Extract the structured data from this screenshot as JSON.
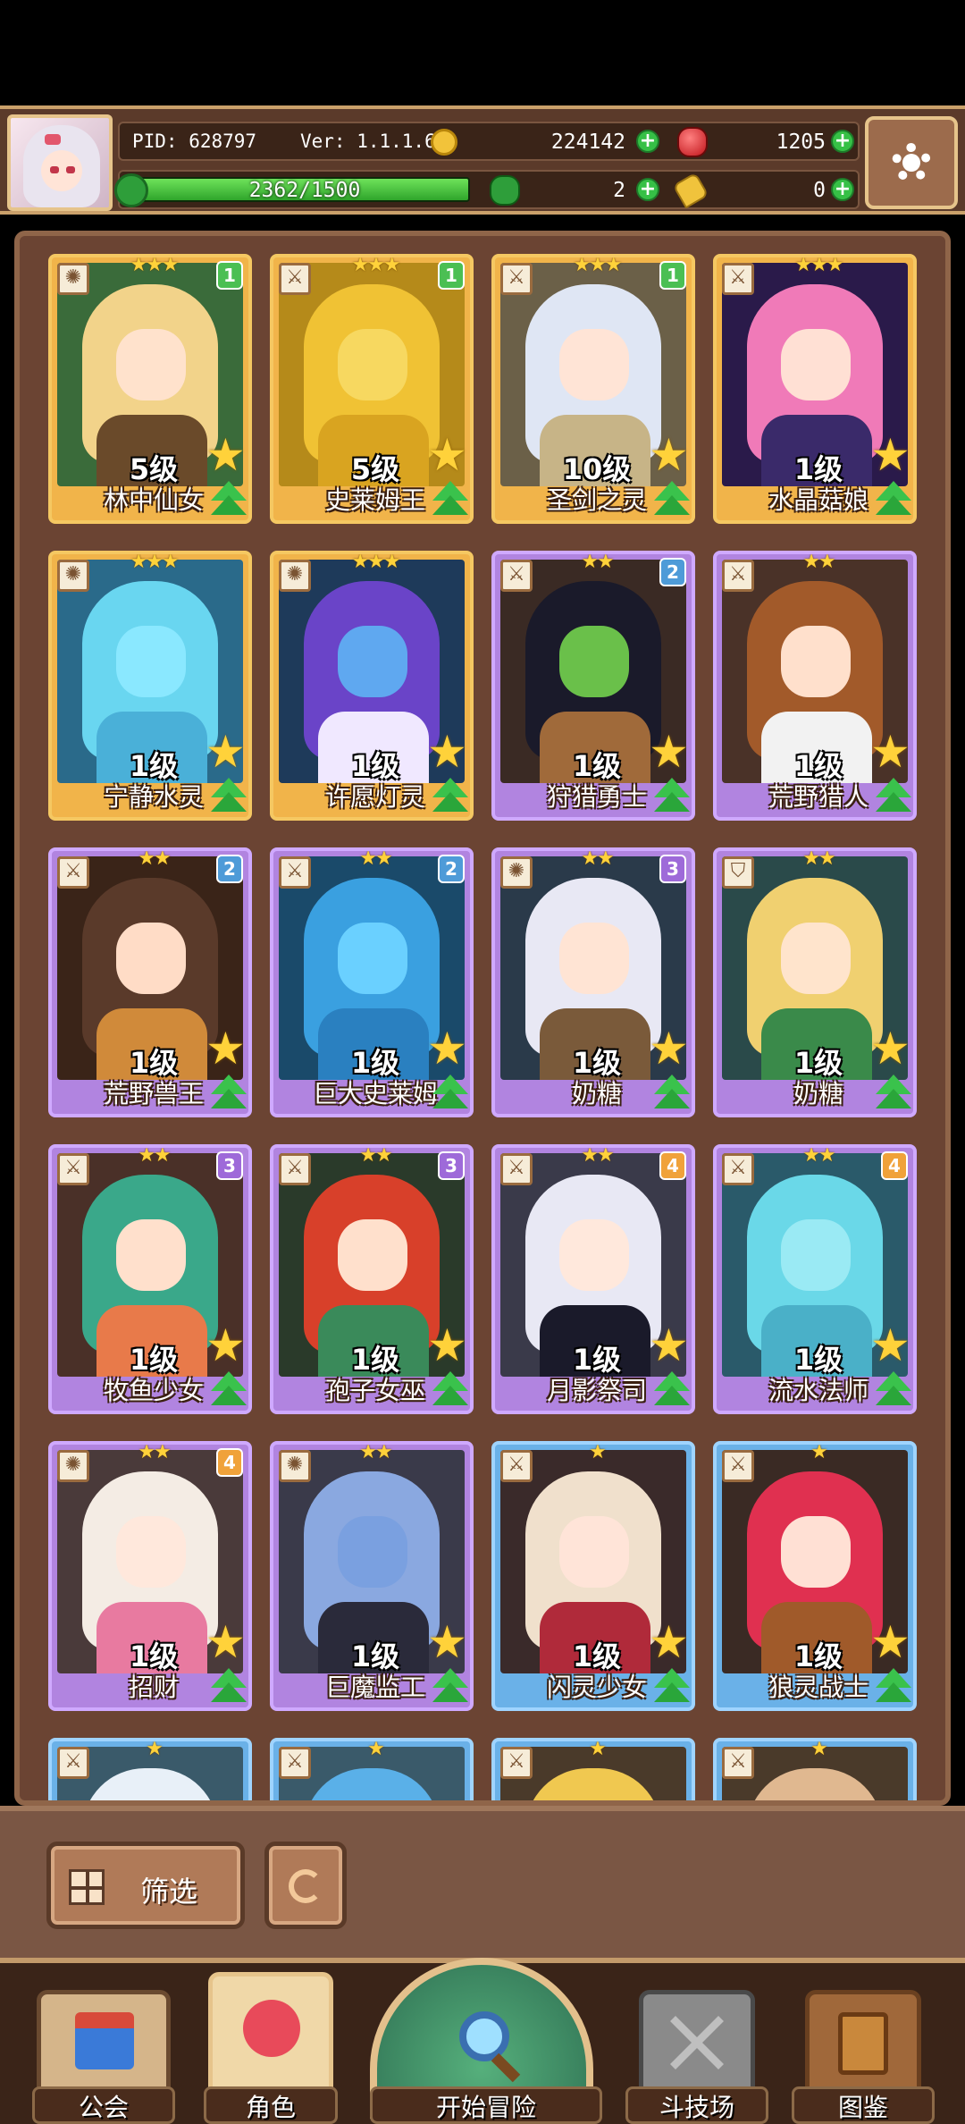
{
  "header": {
    "pid": "PID: 628797",
    "version": "Ver: 1.1.1.6",
    "gold": "224142",
    "gems": "1205",
    "stamina": "2362/1500",
    "stamina_fill": 1.0,
    "clovers": "2",
    "keys": "0",
    "plus_symbol": "+"
  },
  "cards": [
    {
      "name": "林中仙女",
      "level": "5级",
      "stars": "★★★",
      "copies": "1",
      "frame": "gold",
      "badge": "green",
      "icon": "gear-icon",
      "palette": [
        "#3a6b3a",
        "#f2d38a",
        "#ffe2cc",
        "#6a4a2a"
      ]
    },
    {
      "name": "史莱姆王",
      "level": "5级",
      "stars": "★★★",
      "copies": "1",
      "frame": "gold",
      "badge": "green",
      "icon": "sword-icon",
      "palette": [
        "#b58a1a",
        "#f0c234",
        "#f7d860",
        "#d9a420"
      ]
    },
    {
      "name": "圣剑之灵",
      "level": "10级",
      "stars": "★★★",
      "copies": "1",
      "frame": "gold",
      "badge": "green",
      "icon": "sword-icon",
      "palette": [
        "#6b6048",
        "#dfe6f4",
        "#ffe4d6",
        "#c7b487"
      ]
    },
    {
      "name": "水晶菇娘",
      "level": "1级",
      "stars": "★★★",
      "copies": "",
      "frame": "gold",
      "badge": "",
      "icon": "sword-icon",
      "palette": [
        "#2a1a4a",
        "#f07ab8",
        "#ffe0d4",
        "#3a2a6a"
      ]
    },
    {
      "name": "宁静水灵",
      "level": "1级",
      "stars": "★★★",
      "copies": "",
      "frame": "gold",
      "badge": "",
      "icon": "gear-icon",
      "palette": [
        "#2a6a8a",
        "#69d6f0",
        "#8ae8ff",
        "#4ab0d8"
      ]
    },
    {
      "name": "许愿灯灵",
      "level": "1级",
      "stars": "★★★",
      "copies": "",
      "frame": "gold",
      "badge": "",
      "icon": "gear-icon",
      "palette": [
        "#1e3a5a",
        "#6a44c8",
        "#5fa8f0",
        "#f0e8ff"
      ]
    },
    {
      "name": "狩猎勇士",
      "level": "1级",
      "stars": "★★",
      "copies": "2",
      "frame": "purple",
      "badge": "blue",
      "icon": "sword-icon",
      "palette": [
        "#3a2a24",
        "#1a1a2a",
        "#6ac04a",
        "#a06a3a"
      ]
    },
    {
      "name": "荒野猎人",
      "level": "1级",
      "stars": "★★",
      "copies": "",
      "frame": "purple",
      "badge": "",
      "icon": "sword-icon",
      "palette": [
        "#4a3228",
        "#a25a2a",
        "#ffe0cc",
        "#f2f2f2"
      ]
    },
    {
      "name": "荒野兽王",
      "level": "1级",
      "stars": "★★",
      "copies": "2",
      "frame": "purple",
      "badge": "blue",
      "icon": "sword-icon",
      "palette": [
        "#3a2418",
        "#5a3a2a",
        "#ffdcc6",
        "#d08a3a"
      ]
    },
    {
      "name": "巨大史莱姆",
      "level": "1级",
      "stars": "★★",
      "copies": "2",
      "frame": "purple",
      "badge": "blue",
      "icon": "sword-icon",
      "palette": [
        "#1a4a6a",
        "#3aa0e0",
        "#6ad0ff",
        "#2a80c0"
      ]
    },
    {
      "name": "奶糖",
      "level": "1级",
      "stars": "★★",
      "copies": "3",
      "frame": "purple",
      "badge": "purple",
      "icon": "gear-icon",
      "palette": [
        "#2a3a4a",
        "#e8e8f4",
        "#ffe4d4",
        "#7a5a3a"
      ]
    },
    {
      "name": "奶糖",
      "level": "1级",
      "stars": "★★",
      "copies": "",
      "frame": "purple",
      "badge": "",
      "icon": "shield-icon",
      "palette": [
        "#2a4a4a",
        "#f0d070",
        "#ffe4cc",
        "#3a8a4a"
      ]
    },
    {
      "name": "牧鱼少女",
      "level": "1级",
      "stars": "★★",
      "copies": "3",
      "frame": "purple",
      "badge": "purple",
      "icon": "sword-icon",
      "palette": [
        "#4a3028",
        "#3aa88a",
        "#ffe0cc",
        "#e87a4a"
      ]
    },
    {
      "name": "孢子女巫",
      "level": "1级",
      "stars": "★★",
      "copies": "3",
      "frame": "purple",
      "badge": "purple",
      "icon": "sword-icon",
      "palette": [
        "#2a3a2a",
        "#d8402a",
        "#ffe0cc",
        "#3a8a5a"
      ]
    },
    {
      "name": "月影祭司",
      "level": "1级",
      "stars": "★★",
      "copies": "4",
      "frame": "purple",
      "badge": "orange",
      "icon": "sword-icon",
      "palette": [
        "#3a3a4a",
        "#e8e8f4",
        "#ffe8dc",
        "#1a1a2a"
      ]
    },
    {
      "name": "流水法师",
      "level": "1级",
      "stars": "★★",
      "copies": "4",
      "frame": "purple",
      "badge": "orange",
      "icon": "sword-icon",
      "palette": [
        "#2a5a6a",
        "#6ad8e8",
        "#9aeaf4",
        "#4ab0c8"
      ]
    },
    {
      "name": "招财",
      "level": "1级",
      "stars": "★★",
      "copies": "4",
      "frame": "purple",
      "badge": "orange",
      "icon": "gear-icon",
      "palette": [
        "#4a3a3a",
        "#f4ece4",
        "#ffe8dc",
        "#e87aa0"
      ]
    },
    {
      "name": "巨魔监工",
      "level": "1级",
      "stars": "★★",
      "copies": "",
      "frame": "purple",
      "badge": "",
      "icon": "gear-icon",
      "palette": [
        "#3a3a4a",
        "#8aa8e0",
        "#7aa0e0",
        "#2a2a3a"
      ]
    },
    {
      "name": "闪灵少女",
      "level": "1级",
      "stars": "★",
      "copies": "",
      "frame": "blue",
      "badge": "",
      "icon": "sword-icon",
      "palette": [
        "#3a2a2a",
        "#f0e0cc",
        "#ffe4d8",
        "#b02a3a"
      ]
    },
    {
      "name": "狼灵战士",
      "level": "1级",
      "stars": "★",
      "copies": "",
      "frame": "blue",
      "badge": "",
      "icon": "sword-icon",
      "palette": [
        "#3a2a24",
        "#e03050",
        "#ffe0d4",
        "#a05a2a"
      ]
    },
    {
      "name": "",
      "level": "",
      "stars": "★",
      "copies": "",
      "frame": "blue",
      "badge": "",
      "icon": "sword-icon",
      "palette": [
        "#3a5a6a",
        "#e8f0f8",
        "#ffe4d8",
        "#4a8ac0"
      ]
    },
    {
      "name": "",
      "level": "",
      "stars": "★",
      "copies": "",
      "frame": "blue",
      "badge": "",
      "icon": "sword-icon",
      "palette": [
        "#3a5a6a",
        "#5ab0e8",
        "#8ad0ff",
        "#4a8ac0"
      ]
    },
    {
      "name": "",
      "level": "",
      "stars": "★",
      "copies": "",
      "frame": "blue",
      "badge": "",
      "icon": "sword-icon",
      "palette": [
        "#4a3a2a",
        "#f0c850",
        "#ffe4d8",
        "#c08a3a"
      ]
    },
    {
      "name": "",
      "level": "",
      "stars": "★",
      "copies": "",
      "frame": "blue",
      "badge": "",
      "icon": "sword-icon",
      "palette": [
        "#4a3a2a",
        "#e0b890",
        "#ffe4d8",
        "#a07a5a"
      ]
    }
  ],
  "filter": {
    "label": "筛选"
  },
  "nav": {
    "guild": "公会",
    "character": "角色",
    "adventure": "开始冒险",
    "arena": "斗技场",
    "codex": "图鉴"
  },
  "colors": {
    "gold_frame": "#f1b44a",
    "purple_frame": "#b184e0",
    "blue_frame": "#6ab1e8",
    "plus_green": "#36c046"
  }
}
